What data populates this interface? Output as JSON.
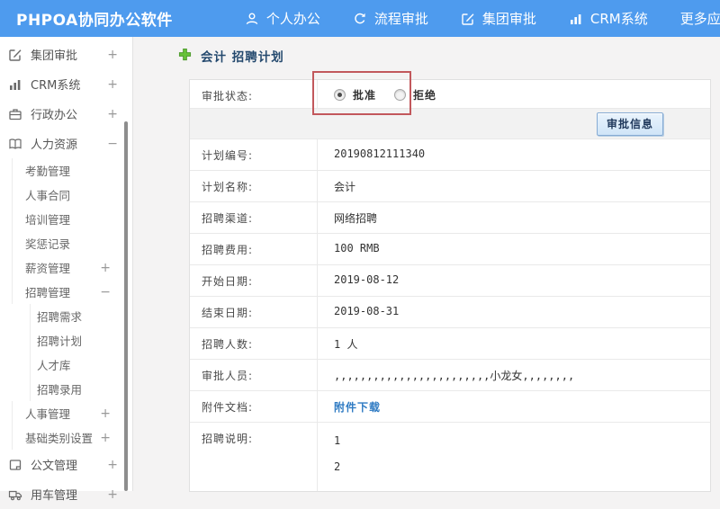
{
  "colors": {
    "topbar_blue": "#4e9bee",
    "annotation_red": "#c2585c",
    "link_blue": "#2f7bc3",
    "breadcrumb_navy": "#24496e",
    "button_face": "#cfe4f7"
  },
  "header": {
    "title": "PHPOA协同办公软件",
    "nav": [
      {
        "name": "personal-office",
        "label": "个人办公",
        "icon": "user-icon"
      },
      {
        "name": "process-approval",
        "label": "流程审批",
        "icon": "flow-icon"
      },
      {
        "name": "group-approval",
        "label": "集团审批",
        "icon": "edit-square-icon"
      },
      {
        "name": "crm-system",
        "label": "CRM系统",
        "icon": "bar-chart-icon"
      },
      {
        "name": "more-apps",
        "label": "更多应用",
        "icon": "caret-down-icon"
      }
    ]
  },
  "sidebar": {
    "items": [
      {
        "name": "group-approval",
        "label": "集团审批",
        "icon": "edit-square-icon",
        "toggle": "+",
        "level": 1
      },
      {
        "name": "crm-system",
        "label": "CRM系统",
        "icon": "bar-chart-icon",
        "toggle": "+",
        "level": 1
      },
      {
        "name": "admin-office",
        "label": "行政办公",
        "icon": "briefcase-icon",
        "toggle": "+",
        "level": 1
      },
      {
        "name": "human-resources",
        "label": "人力资源",
        "icon": "book-icon",
        "toggle": "−",
        "level": 1
      },
      {
        "name": "attendance-mgmt",
        "label": "考勤管理",
        "level": 2
      },
      {
        "name": "hr-contract",
        "label": "人事合同",
        "level": 2
      },
      {
        "name": "training-mgmt",
        "label": "培训管理",
        "level": 2
      },
      {
        "name": "reward-punish-records",
        "label": "奖惩记录",
        "level": 2
      },
      {
        "name": "salary-mgmt",
        "label": "薪资管理",
        "toggle": "+",
        "level": 2
      },
      {
        "name": "recruit-mgmt",
        "label": "招聘管理",
        "toggle": "−",
        "level": 2
      },
      {
        "name": "recruit-demand",
        "label": "招聘需求",
        "level": 3
      },
      {
        "name": "recruit-plan",
        "label": "招聘计划",
        "level": 3
      },
      {
        "name": "talent-pool",
        "label": "人才库",
        "level": 3
      },
      {
        "name": "recruit-hiring",
        "label": "招聘录用",
        "level": 3
      },
      {
        "name": "personnel-mgmt",
        "label": "人事管理",
        "toggle": "+",
        "level": 2
      },
      {
        "name": "base-category-settings",
        "label": "基础类别设置",
        "toggle": "+",
        "level": 2
      },
      {
        "name": "document-mgmt",
        "label": "公文管理",
        "icon": "document-icon",
        "toggle": "+",
        "level": 1
      },
      {
        "name": "vehicle-mgmt",
        "label": "用车管理",
        "icon": "truck-icon",
        "toggle": "+",
        "level": 1
      }
    ]
  },
  "main": {
    "breadcrumb": "会计 招聘计划",
    "approval_status": {
      "label": "审批状态:",
      "options": [
        {
          "label": "批准",
          "checked": true
        },
        {
          "label": "拒绝",
          "checked": false
        }
      ]
    },
    "approve_button_label": "审批信息",
    "fields": [
      {
        "name": "plan-number",
        "label": "计划编号:",
        "value": "20190812111340"
      },
      {
        "name": "plan-name",
        "label": "计划名称:",
        "value": "会计"
      },
      {
        "name": "recruit-channel",
        "label": "招聘渠道:",
        "value": "网络招聘"
      },
      {
        "name": "recruit-cost",
        "label": "招聘费用:",
        "value": "100 RMB"
      },
      {
        "name": "start-date",
        "label": "开始日期:",
        "value": "2019-08-12"
      },
      {
        "name": "end-date",
        "label": "结束日期:",
        "value": "2019-08-31"
      },
      {
        "name": "recruit-headcount",
        "label": "招聘人数:",
        "value": "1 人"
      },
      {
        "name": "approvers",
        "label": "审批人员:",
        "value": ",,,,,,,,,,,,,,,,,,,,,,,,小龙女,,,,,,,,"
      },
      {
        "name": "attachment",
        "label": "附件文档:",
        "value": "附件下载",
        "link": true
      },
      {
        "name": "recruit-description",
        "label": "招聘说明:",
        "lines": [
          "1",
          "2"
        ]
      }
    ]
  }
}
